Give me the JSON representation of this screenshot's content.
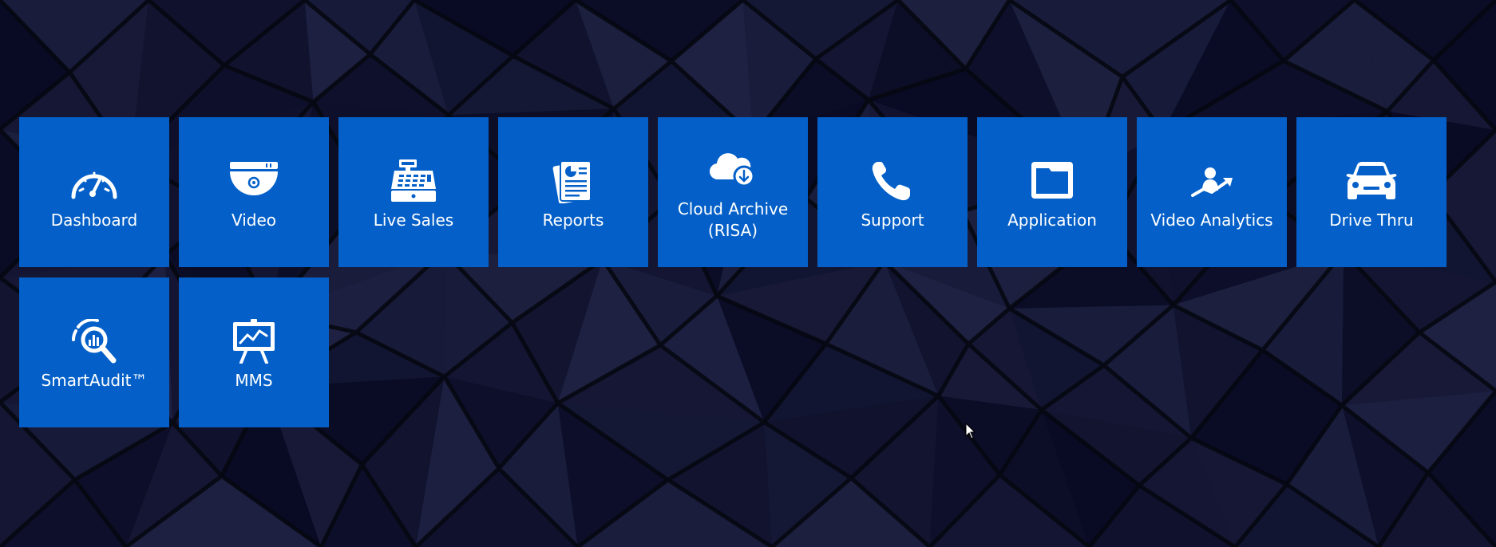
{
  "background": {
    "color": "#0d1224"
  },
  "accent_color": "#0460c8",
  "tiles": [
    {
      "label": "Dashboard",
      "icon": "speedometer-icon"
    },
    {
      "label": "Video",
      "icon": "dome-camera-icon"
    },
    {
      "label": "Live Sales",
      "icon": "cash-register-icon"
    },
    {
      "label": "Reports",
      "icon": "report-document-icon"
    },
    {
      "label": "Cloud Archive (RISA)",
      "icon": "cloud-download-icon"
    },
    {
      "label": "Support",
      "icon": "phone-icon"
    },
    {
      "label": "Application",
      "icon": "folder-window-icon"
    },
    {
      "label": "Video Analytics",
      "icon": "person-trend-icon"
    },
    {
      "label": "Drive Thru",
      "icon": "car-icon"
    },
    {
      "label": "SmartAudit™",
      "icon": "magnifier-chart-icon"
    },
    {
      "label": "MMS",
      "icon": "presentation-board-icon"
    }
  ]
}
